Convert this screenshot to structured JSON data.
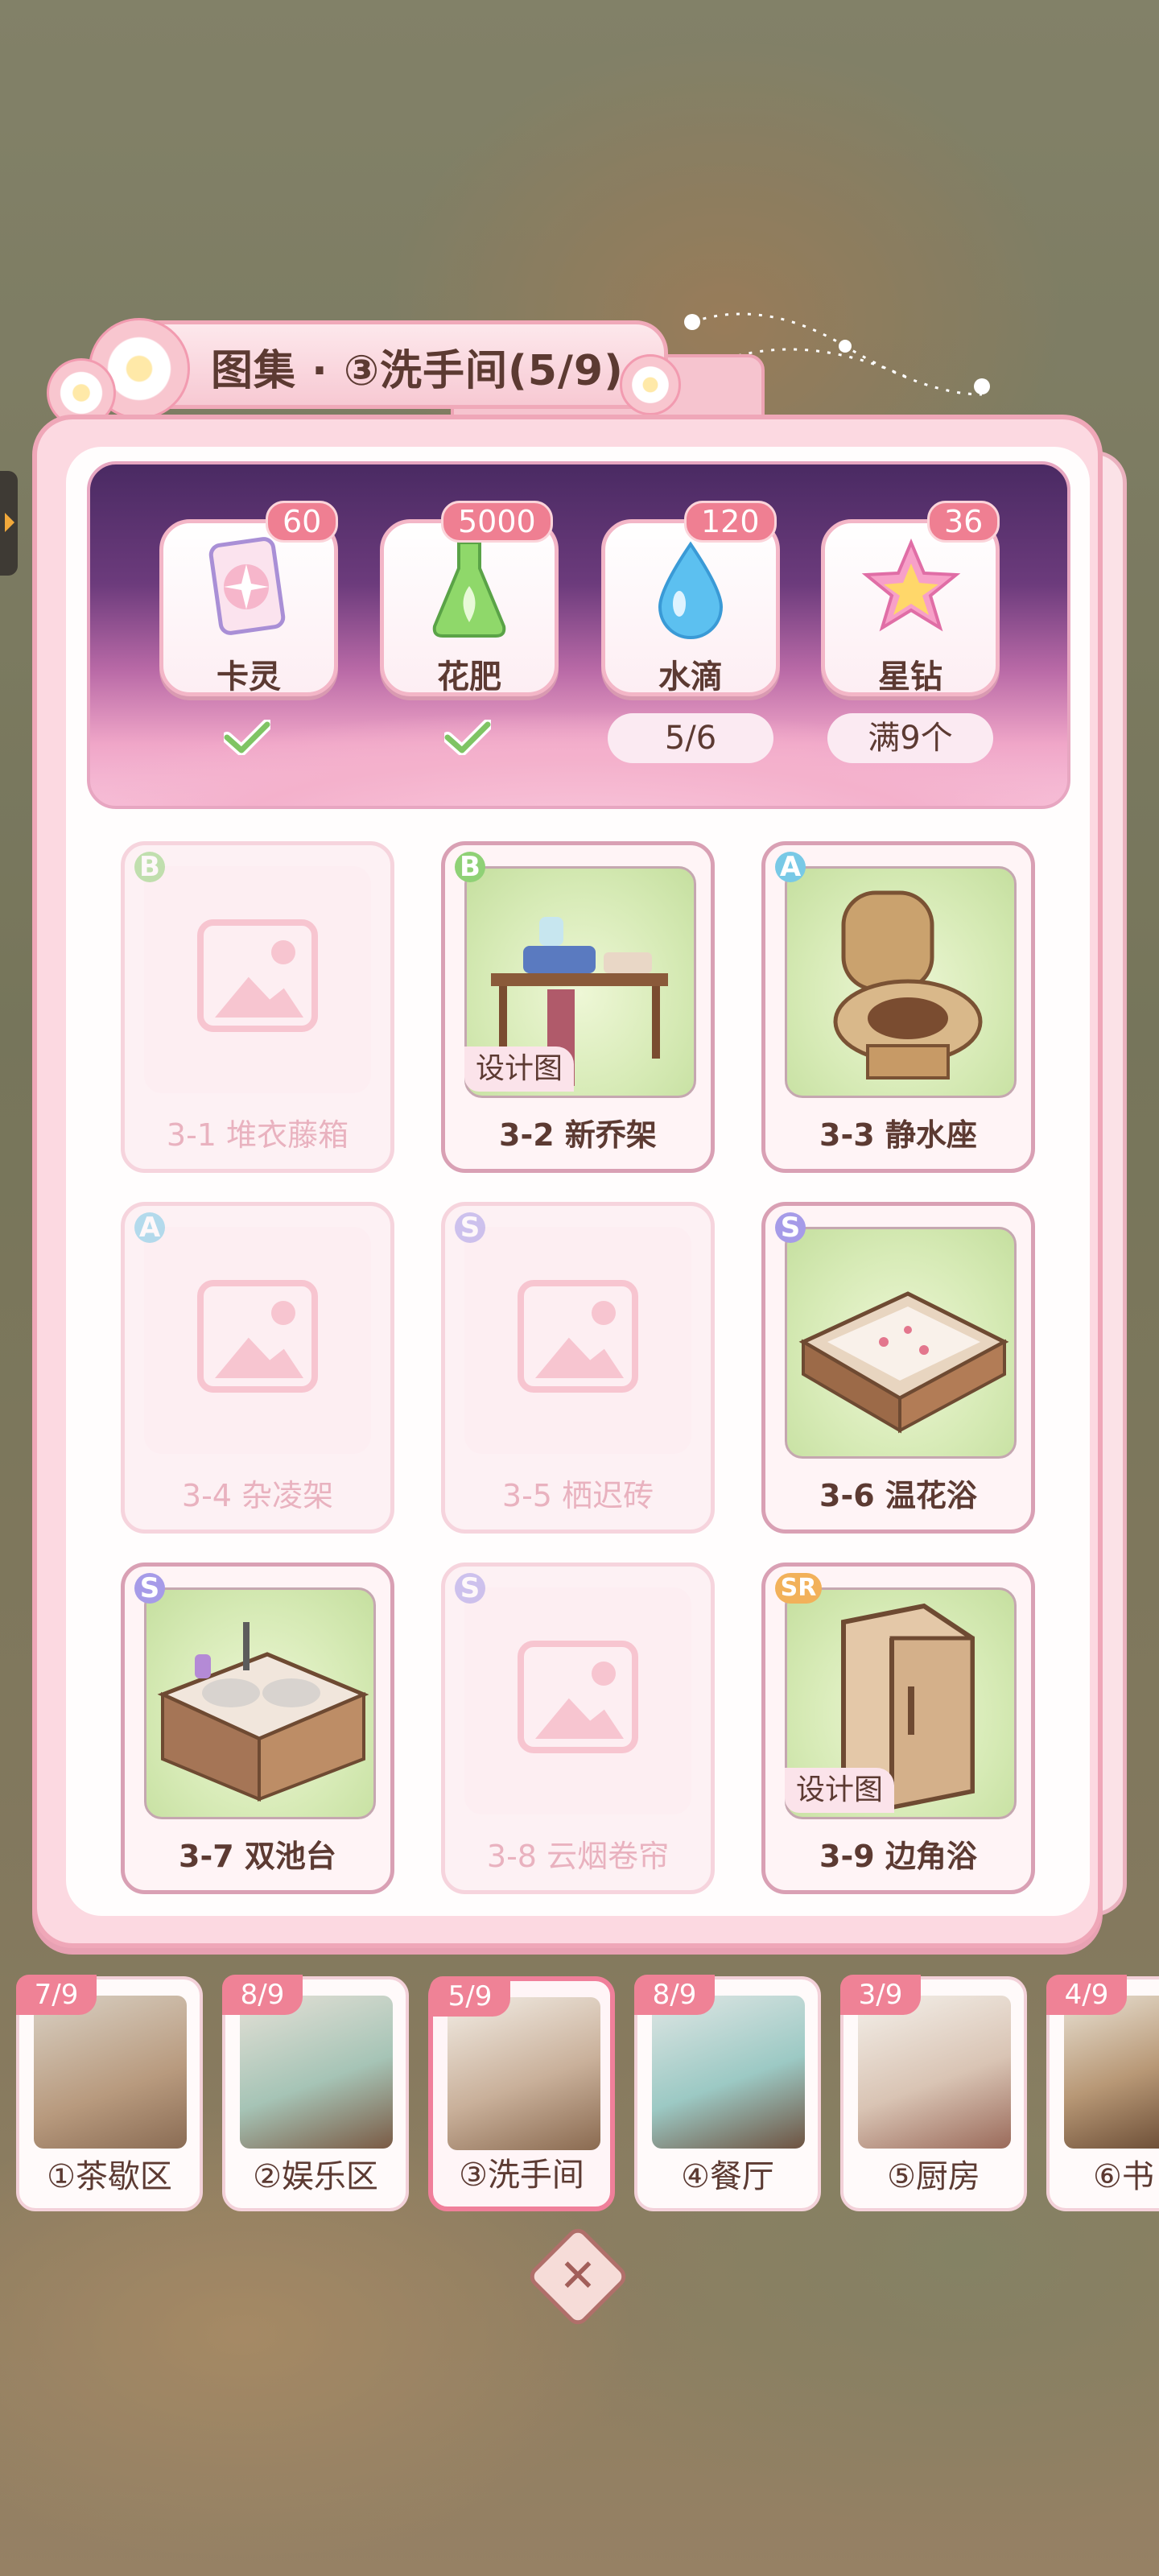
{
  "title": "图集 · ③洗手间(5/9)",
  "resources": [
    {
      "label": "卡灵",
      "badge": "60",
      "status": "check"
    },
    {
      "label": "花肥",
      "badge": "5000",
      "status": "check"
    },
    {
      "label": "水滴",
      "badge": "120",
      "status": "5/6"
    },
    {
      "label": "星钻",
      "badge": "36",
      "status": "满9个"
    }
  ],
  "items": [
    {
      "id": "3-1",
      "name": "3-1 堆衣藤箱",
      "rarity": "B",
      "unlocked": false,
      "blueprint": ""
    },
    {
      "id": "3-2",
      "name": "3-2 新乔架",
      "rarity": "B",
      "unlocked": true,
      "blueprint": "设计图"
    },
    {
      "id": "3-3",
      "name": "3-3 静水座",
      "rarity": "A",
      "unlocked": true,
      "blueprint": ""
    },
    {
      "id": "3-4",
      "name": "3-4 杂凌架",
      "rarity": "A",
      "unlocked": false,
      "blueprint": ""
    },
    {
      "id": "3-5",
      "name": "3-5 栖迟砖",
      "rarity": "S",
      "unlocked": false,
      "blueprint": ""
    },
    {
      "id": "3-6",
      "name": "3-6 温花浴",
      "rarity": "S",
      "unlocked": true,
      "blueprint": ""
    },
    {
      "id": "3-7",
      "name": "3-7 双池台",
      "rarity": "S",
      "unlocked": true,
      "blueprint": ""
    },
    {
      "id": "3-8",
      "name": "3-8 云烟卷帘",
      "rarity": "S",
      "unlocked": false,
      "blueprint": ""
    },
    {
      "id": "3-9",
      "name": "3-9 边角浴",
      "rarity": "SR",
      "unlocked": true,
      "blueprint": "设计图"
    }
  ],
  "zones": [
    {
      "label": "①茶歇区",
      "progress": "7/9",
      "active": false
    },
    {
      "label": "②娱乐区",
      "progress": "8/9",
      "active": false
    },
    {
      "label": "③洗手间",
      "progress": "5/9",
      "active": true
    },
    {
      "label": "④餐厅",
      "progress": "8/9",
      "active": false
    },
    {
      "label": "⑤厨房",
      "progress": "3/9",
      "active": false
    },
    {
      "label": "⑥书",
      "progress": "4/9",
      "active": false
    }
  ],
  "colors": {
    "accent": "#ef7f92",
    "text": "#5c3a32",
    "panel": "#fcd9e1"
  },
  "icons": {
    "close": "close-icon",
    "check": "check-icon"
  }
}
